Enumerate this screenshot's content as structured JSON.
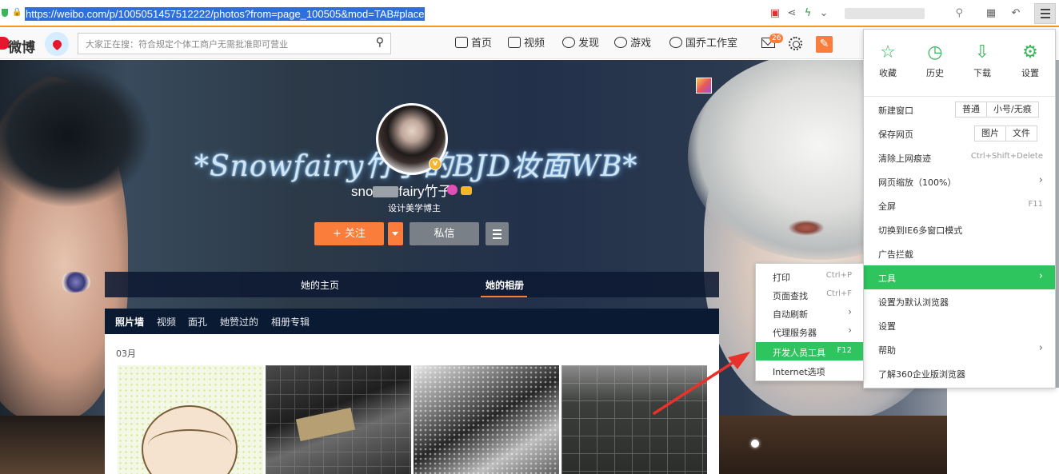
{
  "browser": {
    "url": "https://weibo.com/p/1005051457512222/photos?from=page_100505&mod=TAB#place"
  },
  "weibo_nav": {
    "logo_text": "微博",
    "search_placeholder": "大家正在搜：符合规定个体工商户无需批准即可营业",
    "items": [
      {
        "label": "首页",
        "icon": "home-icon"
      },
      {
        "label": "视频",
        "icon": "video-icon"
      },
      {
        "label": "发现",
        "icon": "compass-icon"
      },
      {
        "label": "游戏",
        "icon": "gamepad-icon"
      },
      {
        "label": "国乔工作室",
        "icon": "user-icon"
      }
    ],
    "message_count": "26"
  },
  "profile": {
    "cover_title": "*Snowfairy竹子的BJD妆面WB*",
    "username_prefix": "sno",
    "username_suffix": "fairy竹子",
    "tag": "设计美学博主",
    "follow_label": "+ 关注",
    "message_label": "私信",
    "tabs": [
      "她的主页",
      "她的相册"
    ],
    "album_subnav": [
      "照片墙",
      "视频",
      "面孔",
      "她赞过的",
      "相册专辑"
    ],
    "month": "03月"
  },
  "main_menu": {
    "top_items": [
      {
        "label": "收藏",
        "icon": "star-icon"
      },
      {
        "label": "历史",
        "icon": "clock-icon"
      },
      {
        "label": "下载",
        "icon": "download-icon"
      },
      {
        "label": "设置",
        "icon": "gear-icon"
      }
    ],
    "new_window": {
      "label": "新建窗口",
      "options": [
        "普通",
        "小号/无痕"
      ]
    },
    "save_page": {
      "label": "保存网页",
      "options": [
        "图片",
        "文件"
      ]
    },
    "clear_history": {
      "label": "清除上网痕迹",
      "shortcut": "Ctrl+Shift+Delete"
    },
    "zoom": {
      "label": "网页缩放（100%）"
    },
    "fullscreen": {
      "label": "全屏",
      "shortcut": "F11"
    },
    "ie6": {
      "label": "切换到IE6多窗口模式"
    },
    "adblock": {
      "label": "广告拦截"
    },
    "tools": {
      "label": "工具"
    },
    "default_browser": {
      "label": "设置为默认浏览器"
    },
    "settings": {
      "label": "设置"
    },
    "help": {
      "label": "帮助"
    },
    "enterprise": {
      "label": "了解360企业版浏览器"
    }
  },
  "tools_submenu": {
    "items": [
      {
        "label": "打印",
        "shortcut": "Ctrl+P"
      },
      {
        "label": "页面查找",
        "shortcut": "Ctrl+F"
      },
      {
        "label": "自动刷新",
        "shortcut": ""
      },
      {
        "label": "代理服务器",
        "shortcut": ""
      },
      {
        "label": "开发人员工具",
        "shortcut": "F12"
      },
      {
        "label": "Internet选项",
        "shortcut": ""
      }
    ]
  },
  "colors": {
    "accent_green": "#2ec55f",
    "weibo_orange": "#fa7d3c",
    "url_highlight": "#2f6fd9",
    "annotation_red": "#e8312a"
  }
}
